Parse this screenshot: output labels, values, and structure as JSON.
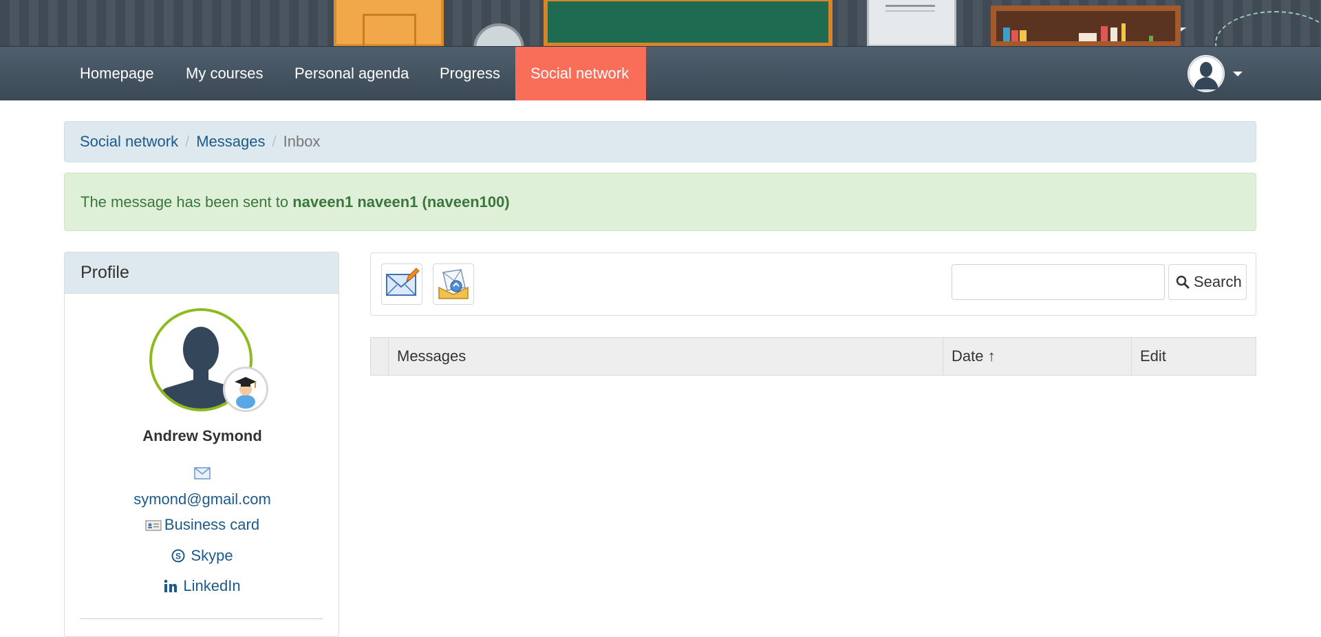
{
  "nav": {
    "items": [
      {
        "label": "Homepage",
        "active": false
      },
      {
        "label": "My courses",
        "active": false
      },
      {
        "label": "Personal agenda",
        "active": false
      },
      {
        "label": "Progress",
        "active": false
      },
      {
        "label": "Social network",
        "active": true
      }
    ],
    "active_color": "#f86e59"
  },
  "breadcrumb": {
    "items": [
      "Social network",
      "Messages"
    ],
    "separator": "/",
    "current": "Inbox"
  },
  "alert": {
    "text": "The message has been sent to ",
    "recipient": "naveen1 naveen1 (naveen100)"
  },
  "profile": {
    "heading": "Profile",
    "name": "Andrew Symond",
    "email": "symond@gmail.com",
    "business_card_label": "Business card",
    "skype_label": "Skype",
    "linkedin_label": "LinkedIn",
    "ring_color": "#8dbb1d"
  },
  "toolbar": {
    "compose_icon": "compose-message-icon",
    "outbox_icon": "sent-messages-icon",
    "search_value": "",
    "search_label": "Search"
  },
  "table": {
    "columns": [
      "Messages",
      "Date ↑",
      "Edit"
    ],
    "rows": []
  }
}
